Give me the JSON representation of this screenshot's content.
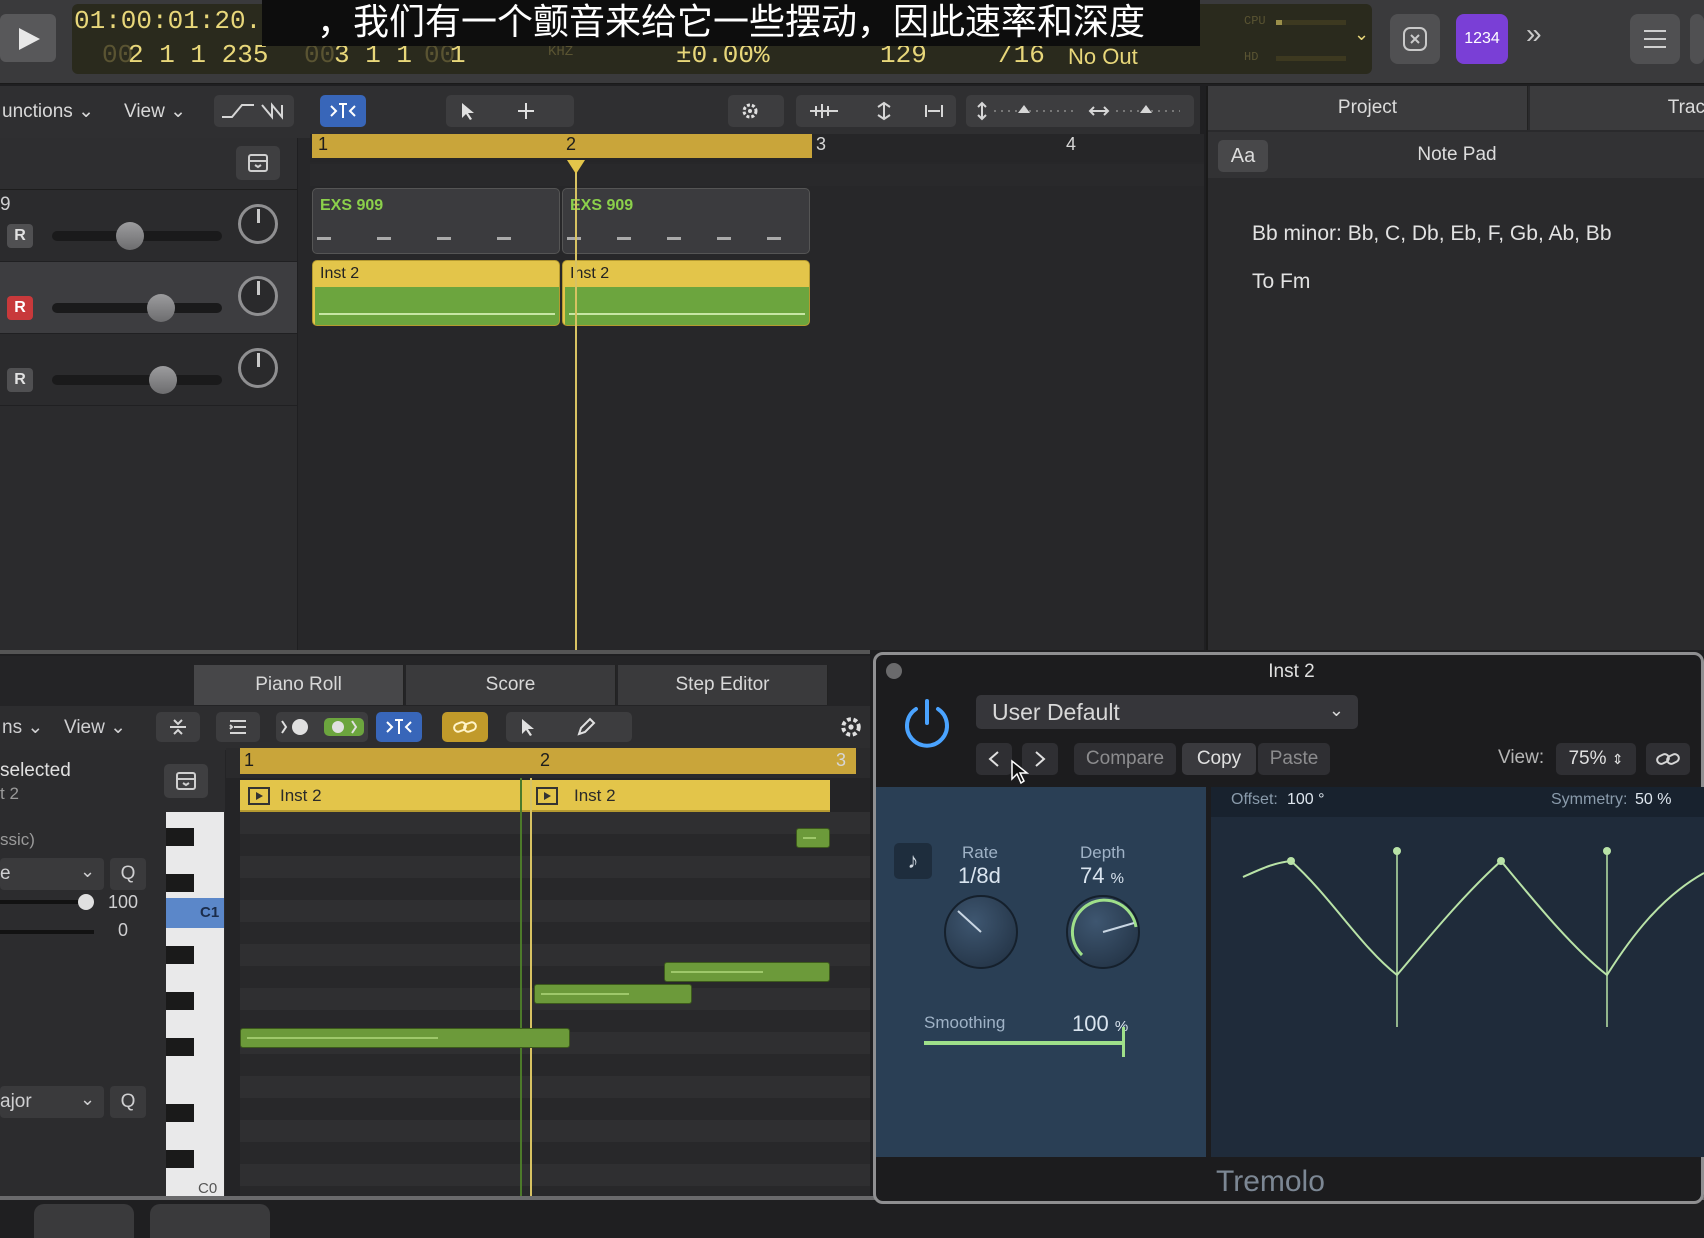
{
  "transport": {
    "time": "01:00:01:20.3",
    "time_dim": "00",
    "position": "2  1  1  235",
    "position_dim": "00",
    "position2": "3  1  1",
    "position2_dim": "00",
    "position2_end": "1",
    "position2_end_dim": "00",
    "tempo_change": "±0.00%",
    "tempo": "129",
    "division": "/16",
    "midi_out": "No Out",
    "khz_label": "KHZ",
    "cpu_label": "CPU",
    "hd_label": "HD"
  },
  "subtitle": "，我们有一个颤音来给它一些摆动，因此速率和深度",
  "top_right": {
    "count_in": "1234",
    "more": "»"
  },
  "arrange_toolbar": {
    "functions": "unctions",
    "view": "View"
  },
  "ruler_marks": [
    "1",
    "2",
    "3",
    "4"
  ],
  "tracks": [
    {
      "number": "9",
      "record": "R",
      "armed": false,
      "volume": 0.45
    },
    {
      "number": "",
      "record": "R",
      "armed": true,
      "volume": 0.67
    },
    {
      "number": "",
      "record": "R",
      "armed": false,
      "volume": 0.68
    }
  ],
  "regions": [
    {
      "label": "EXS 909"
    },
    {
      "label": "EXS 909"
    },
    {
      "label": "Inst 2"
    },
    {
      "label": "Inst 2"
    }
  ],
  "notepad": {
    "tab_project": "Project",
    "tab_track": "Trac",
    "font_button": "Aa",
    "title": "Note Pad",
    "line1": "Bb minor: Bb, C, Db, Eb, F, Gb, Ab, Bb",
    "line2": "To Fm"
  },
  "editor": {
    "tabs": [
      "Piano Roll",
      "Score",
      "Step Editor"
    ],
    "functions": "ns",
    "view": "View",
    "ruler_marks": [
      "1",
      "2",
      "3"
    ],
    "region_labels": [
      "Inst 2",
      "Inst 2"
    ],
    "inspector": {
      "selected": "selected",
      "track": "t 2",
      "classic": "ssic)",
      "mode": "e",
      "q": "Q",
      "velocity": "100",
      "offset": "0",
      "scale": "ajor",
      "q2": "Q"
    },
    "key_labels": {
      "c1": "C1",
      "c0": "C0"
    }
  },
  "plugin": {
    "title": "Inst 2",
    "preset": "User Default",
    "compare": "Compare",
    "copy": "Copy",
    "paste": "Paste",
    "view_label": "View:",
    "zoom": "75%",
    "rate_label": "Rate",
    "rate_value": "1/8d",
    "depth_label": "Depth",
    "depth_value": "74",
    "depth_unit": "%",
    "smoothing_label": "Smoothing",
    "smoothing_value": "100",
    "smoothing_unit": "%",
    "smoothing_level": 1.0,
    "offset_label": "Offset:",
    "offset_value": "100 °",
    "symmetry_label": "Symmetry:",
    "symmetry_value": "50 %",
    "name": "Tremolo"
  },
  "colors": {
    "region_yellow": "#e3c54a",
    "region_green": "#6ca53e",
    "record_red": "#c8393b",
    "accent_blue": "#3866b9",
    "purple": "#7a3fd6",
    "tremolo_curve": "#b9e3a7"
  }
}
